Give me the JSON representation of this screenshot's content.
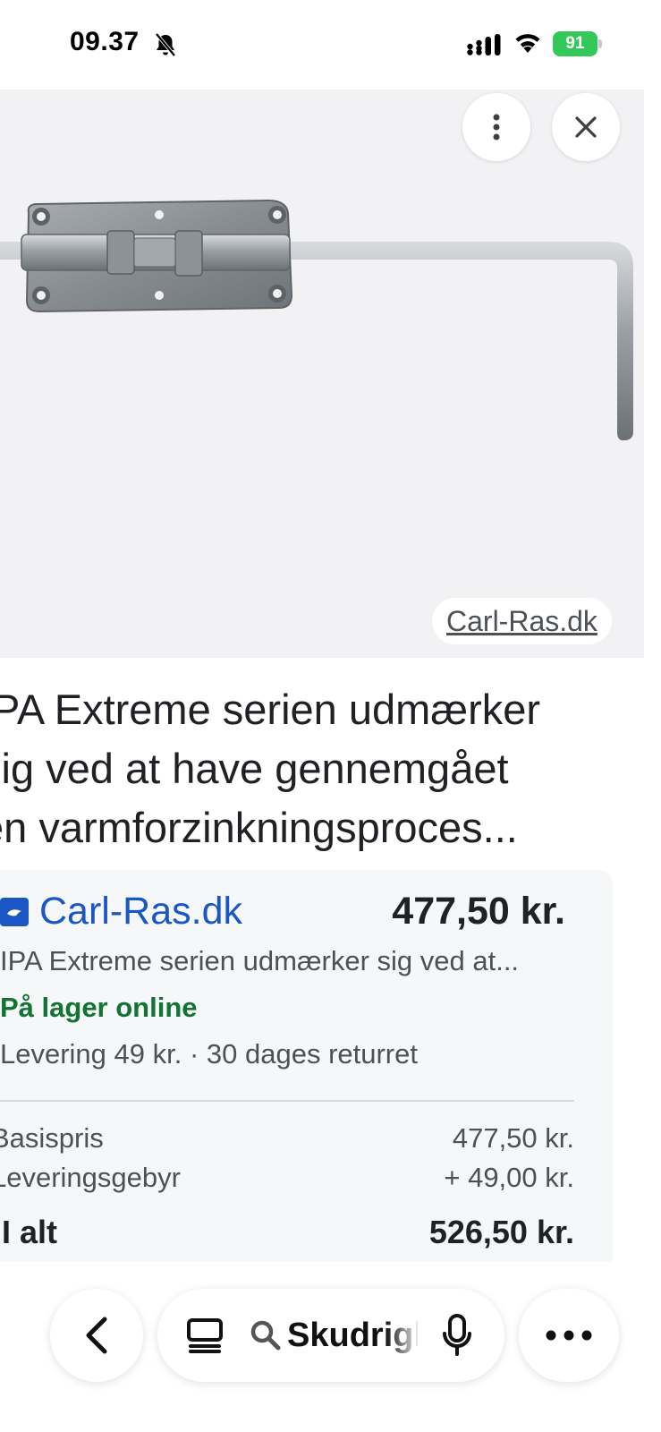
{
  "status_bar": {
    "time": "09.37",
    "battery": "91"
  },
  "image_viewer": {
    "source_label": "Carl-Ras.dk"
  },
  "product": {
    "title_lines": [
      "IPA Extreme serien udmærker",
      "sig ved at have gennemgået",
      "en varmforzinkningsproces..."
    ]
  },
  "offer": {
    "store": "Carl-Ras.dk",
    "price": "477,50 kr.",
    "description": "IPA Extreme serien udmærker sig ved at...",
    "stock": "På lager online",
    "delivery": "Levering 49 kr. · 30 dages returret",
    "base_price_label": "Basispris",
    "base_price_value": "477,50 kr.",
    "delivery_fee_label": "Leveringsgebyr",
    "delivery_fee_value": "+ 49,00 kr.",
    "total_label": "I alt",
    "total_value": "526,50 kr."
  },
  "toolbar": {
    "search_text": "Skudrigl"
  },
  "colors": {
    "link_blue": "#1a56c4",
    "stock_green": "#137333",
    "battery_green": "#34c759"
  }
}
